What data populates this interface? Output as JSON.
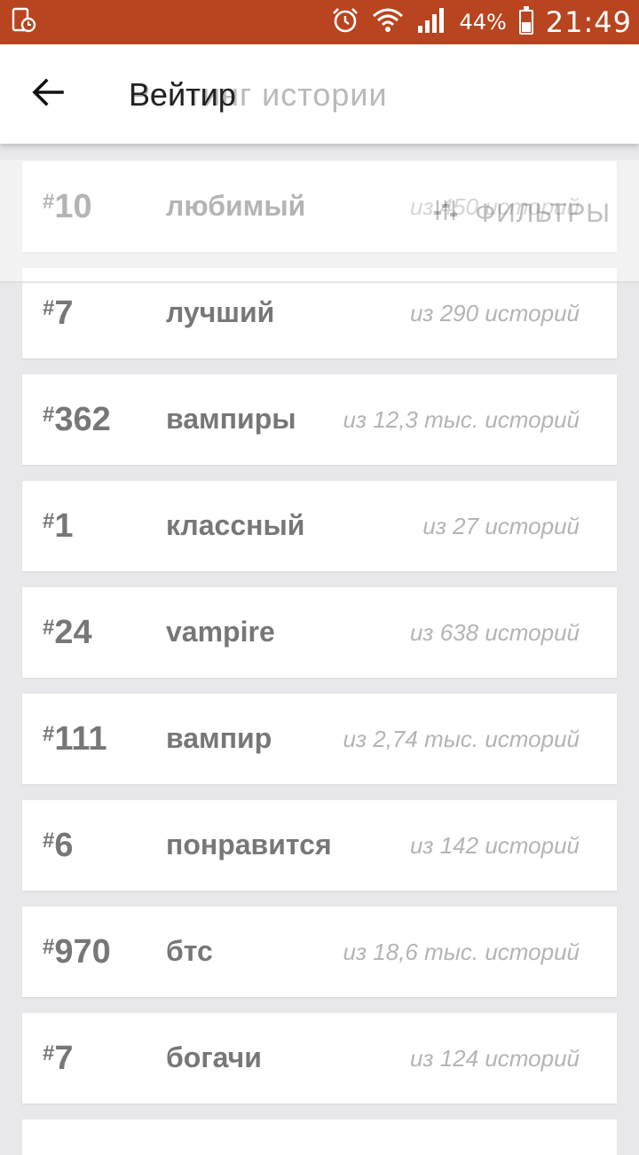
{
  "status_bar": {
    "battery": "44%",
    "time": "21:49"
  },
  "app_bar": {
    "title": "Вейтир",
    "title_ghost": "Рейтинг истории",
    "back_icon": "arrow-left-icon"
  },
  "ghost_tabs": {
    "filter_label": "ФИЛЬТРЫ"
  },
  "colors": {
    "status_bar": "#b8451f",
    "background": "#e8e8ea",
    "card": "#ffffff",
    "rank_text": "#777777",
    "count_text": "#b4b4b4"
  },
  "rankings": [
    {
      "hash": "#",
      "rank": "10",
      "tag": "любимый",
      "count": "из 450 историй"
    },
    {
      "hash": "#",
      "rank": "7",
      "tag": "лучший",
      "count": "из 290 историй"
    },
    {
      "hash": "#",
      "rank": "362",
      "tag": "вампиры",
      "count": "из 12,3 тыс. историй"
    },
    {
      "hash": "#",
      "rank": "1",
      "tag": "классный",
      "count": "из 27 историй"
    },
    {
      "hash": "#",
      "rank": "24",
      "tag": "vampire",
      "count": "из 638 историй"
    },
    {
      "hash": "#",
      "rank": "111",
      "tag": "вампир",
      "count": "из 2,74 тыс. историй"
    },
    {
      "hash": "#",
      "rank": "6",
      "tag": "понравится",
      "count": "из 142 историй"
    },
    {
      "hash": "#",
      "rank": "970",
      "tag": "бтс",
      "count": "из 18,6 тыс. историй"
    },
    {
      "hash": "#",
      "rank": "7",
      "tag": "богачи",
      "count": "из 124 историй"
    }
  ]
}
